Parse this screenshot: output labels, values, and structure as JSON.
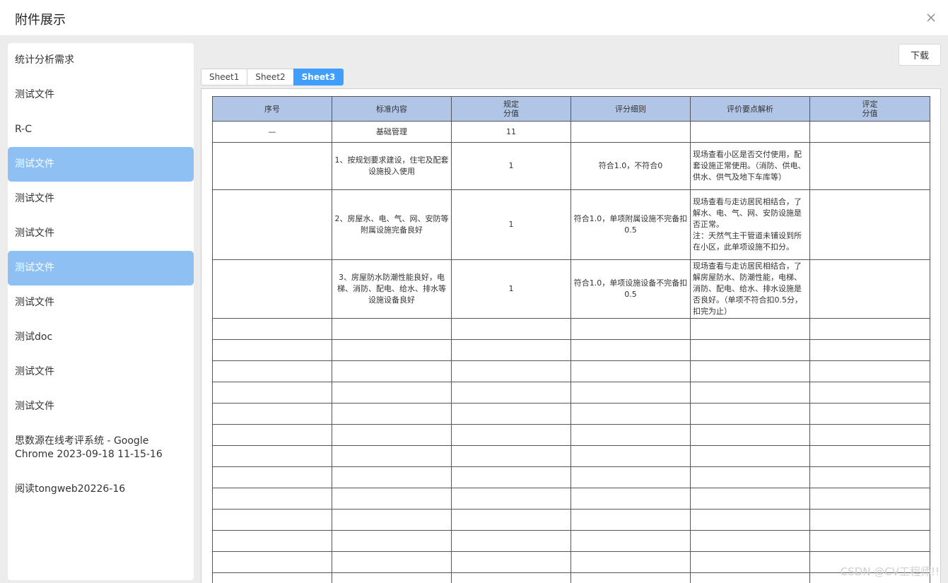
{
  "dialog": {
    "title": "附件展示",
    "close_icon": "close-icon"
  },
  "sidebar": {
    "items": [
      {
        "label": "统计分析需求",
        "active": false
      },
      {
        "label": "测试文件",
        "active": false
      },
      {
        "label": "R-C",
        "active": false
      },
      {
        "label": "测试文件",
        "active": true
      },
      {
        "label": "测试文件",
        "active": false
      },
      {
        "label": "测试文件",
        "active": false
      },
      {
        "label": "测试文件",
        "active": true
      },
      {
        "label": "测试文件",
        "active": false
      },
      {
        "label": "测试doc",
        "active": false
      },
      {
        "label": "测试文件",
        "active": false
      },
      {
        "label": "测试文件",
        "active": false
      },
      {
        "label": "思数源在线考评系统 - Google Chrome 2023-09-18 11-15-16",
        "active": false
      },
      {
        "label": "阅读tongweb20226-16",
        "active": false
      }
    ]
  },
  "toolbar": {
    "download_label": "下载"
  },
  "sheet_tabs": [
    {
      "label": "Sheet1",
      "active": false
    },
    {
      "label": "Sheet2",
      "active": false
    },
    {
      "label": "Sheet3",
      "active": true
    }
  ],
  "table": {
    "headers": [
      "序号",
      "标准内容",
      "规定\n分值",
      "评分细则",
      "评价要点解析",
      "评定\n分值"
    ],
    "rows": [
      [
        "—",
        "基础管理",
        "11",
        "",
        "",
        ""
      ],
      [
        "",
        "1、按规划要求建设，住宅及配套设施投入使用",
        "1",
        "符合1.0，不符合0",
        "现场查看小区是否交付使用，配套设施正常使用。（消防、供电、供水、供气及地下车库等）",
        ""
      ],
      [
        "",
        "2、房屋水、电、气、网、安防等附属设施完备良好",
        "1",
        "符合1.0，单项附属设施不完备扣0.5",
        "现场查看与走访居民相结合，了解水、电、气、网、安防设施是否正常。\n注：天然气主干管道未铺设到所在小区，此单项设施不扣分。",
        ""
      ],
      [
        "",
        "3、房屋防水防潮性能良好，电梯、消防、配电、给水、排水等设施设备良好",
        "1",
        "符合1.0，单项设施设备不完备扣0.5",
        "现场查看与走访居民相结合，了解房屋防水、防潮性能，电梯、消防、配电、给水、排水设施是否良好。（单项不符合扣0.5分，扣完为止）",
        ""
      ]
    ],
    "empty_row_count": 13
  },
  "watermark": "CSDN @CV工程师!!"
}
